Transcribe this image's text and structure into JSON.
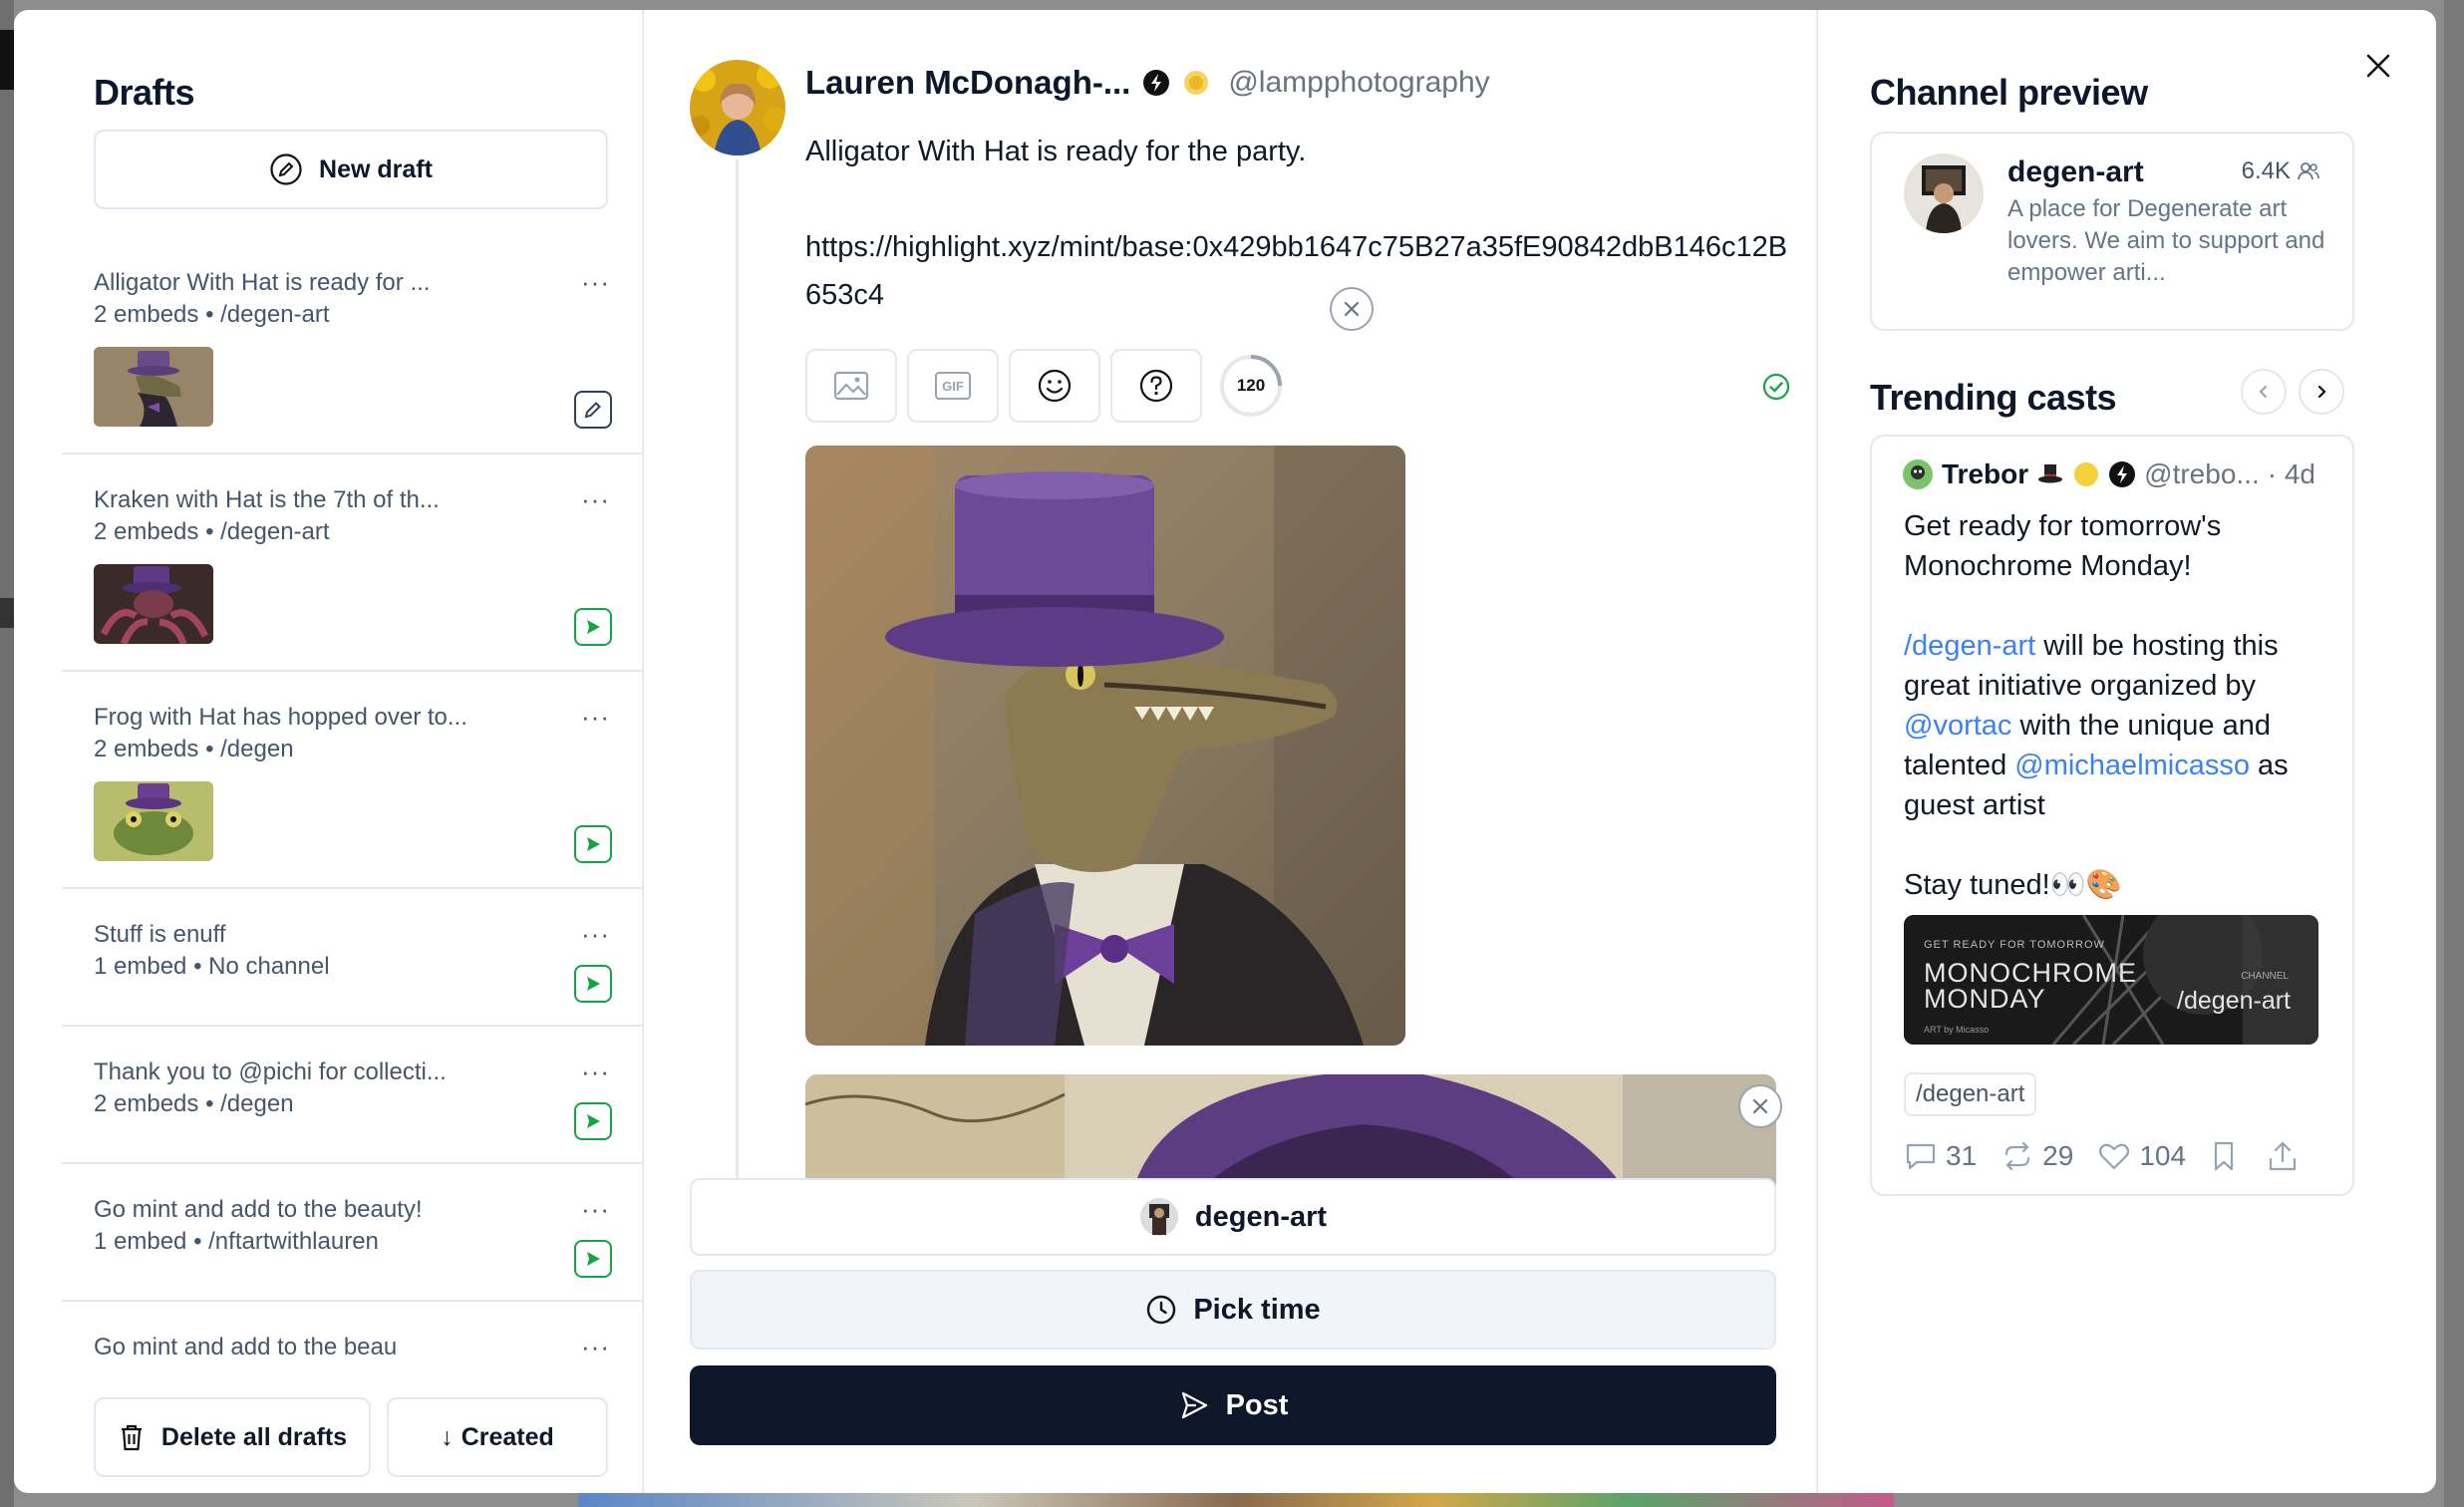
{
  "close_label": "×",
  "drafts": {
    "title": "Drafts",
    "new_draft_label": "New draft",
    "more_label": "···",
    "items": [
      {
        "title": "Alligator With Hat is ready for ...",
        "meta": "2 embeds • /degen-art",
        "thumb": "alligator",
        "action": "edit-icon"
      },
      {
        "title": "Kraken with Hat is the 7th of th...",
        "meta": "2 embeds • /degen-art",
        "thumb": "kraken",
        "action": "send-icon"
      },
      {
        "title": "Frog with Hat has hopped over to...",
        "meta": "2 embeds • /degen",
        "thumb": "frog",
        "action": "send-icon"
      },
      {
        "title": "Stuff is enuff",
        "meta": "1 embed • No channel",
        "thumb": null,
        "action": "send-icon"
      },
      {
        "title": "Thank you to @pichi for collecti...",
        "meta": "2 embeds • /degen",
        "thumb": null,
        "action": "send-icon"
      },
      {
        "title": "Go mint and add to the beauty!",
        "meta": "1 embed • /nftartwithlauren",
        "thumb": null,
        "action": "send-icon"
      },
      {
        "title": "Go mint and add to the beau",
        "meta": "",
        "thumb": null,
        "action": null
      }
    ],
    "delete_all_label": "Delete all drafts",
    "sort_label": "Created",
    "sort_arrow": "↓"
  },
  "composer": {
    "author_name": "Lauren McDonagh-...",
    "author_handle": "@lampphotography",
    "text_line1": "Alligator With Hat is ready for the party.",
    "text_line2": "https://highlight.xyz/mint/base:0x429bb1647c75B27a35fE90842dbB146c12B653c4",
    "char_count": "120",
    "gif_label": "GIF",
    "channel_label": "degen-art",
    "pick_time_label": "Pick time",
    "post_label": "Post",
    "colors": {
      "post_bg": "#0f172a",
      "ok": "#16a34a"
    }
  },
  "channel_preview": {
    "title": "Channel preview",
    "name": "degen-art",
    "member_count": "6.4K",
    "description": "A place for Degenerate art lovers. We aim to support and empower arti..."
  },
  "trending": {
    "title": "Trending casts",
    "cast": {
      "author": "Trebor",
      "handle": "@trebo...",
      "age": "· 4d",
      "p1": "Get ready for tomorrow's Monochrome Monday!",
      "p2_link1": "/degen-art",
      "p2_t1": " will be hosting this great initiative organized by ",
      "p2_link2": "@vortac",
      "p2_t2": " with the unique and talented ",
      "p2_link3": "@michaelmicasso",
      "p2_t3": " as guest artist",
      "p3": "Stay tuned!👀🎨",
      "image_top": "GET READY FOR TOMORROW",
      "image_title_1": "MONOCHROME",
      "image_title_2": "MONDAY",
      "image_small": "CHANNEL",
      "image_channel": "/degen-art",
      "image_footer": "ART by Micasso",
      "channel_pill": "/degen-art",
      "replies": "31",
      "recasts": "29",
      "likes": "104"
    }
  }
}
